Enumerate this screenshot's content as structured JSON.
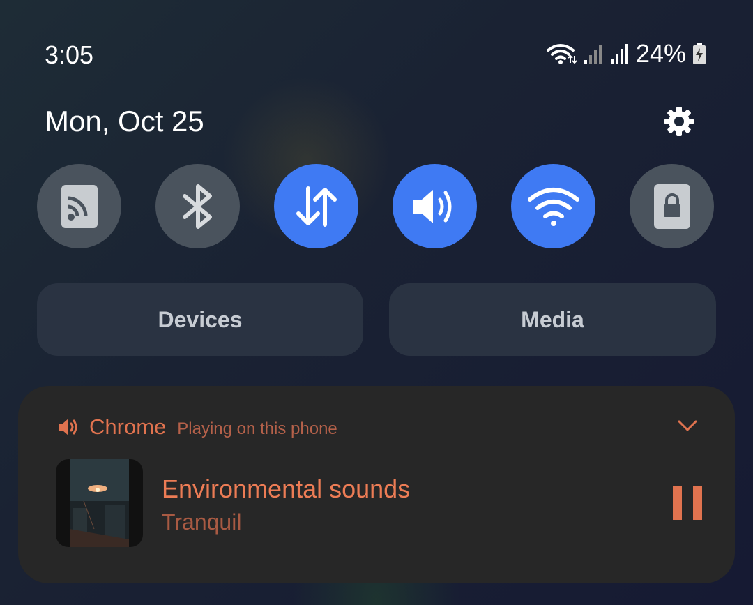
{
  "status": {
    "time": "3:05",
    "battery": "24%"
  },
  "header": {
    "date": "Mon, Oct 25"
  },
  "quick_tiles": [
    {
      "name": "cast",
      "state": "off",
      "icon": "cast-icon"
    },
    {
      "name": "bluetooth",
      "state": "off",
      "icon": "bluetooth-icon"
    },
    {
      "name": "mobile-data",
      "state": "on",
      "icon": "data-arrows-icon"
    },
    {
      "name": "sound",
      "state": "on",
      "icon": "volume-icon"
    },
    {
      "name": "wifi",
      "state": "on",
      "icon": "wifi-icon"
    },
    {
      "name": "secure-folder",
      "state": "off",
      "icon": "lock-icon"
    }
  ],
  "buttons": {
    "devices": "Devices",
    "media": "Media"
  },
  "media": {
    "app": "Chrome",
    "subtitle": "Playing on this phone",
    "title": "Environmental sounds",
    "artist": "Tranquil"
  },
  "colors": {
    "accent_blue": "#3f7af3",
    "tile_off": "#4a535d",
    "media_accent": "#e0734f",
    "card_bg": "#272727"
  }
}
